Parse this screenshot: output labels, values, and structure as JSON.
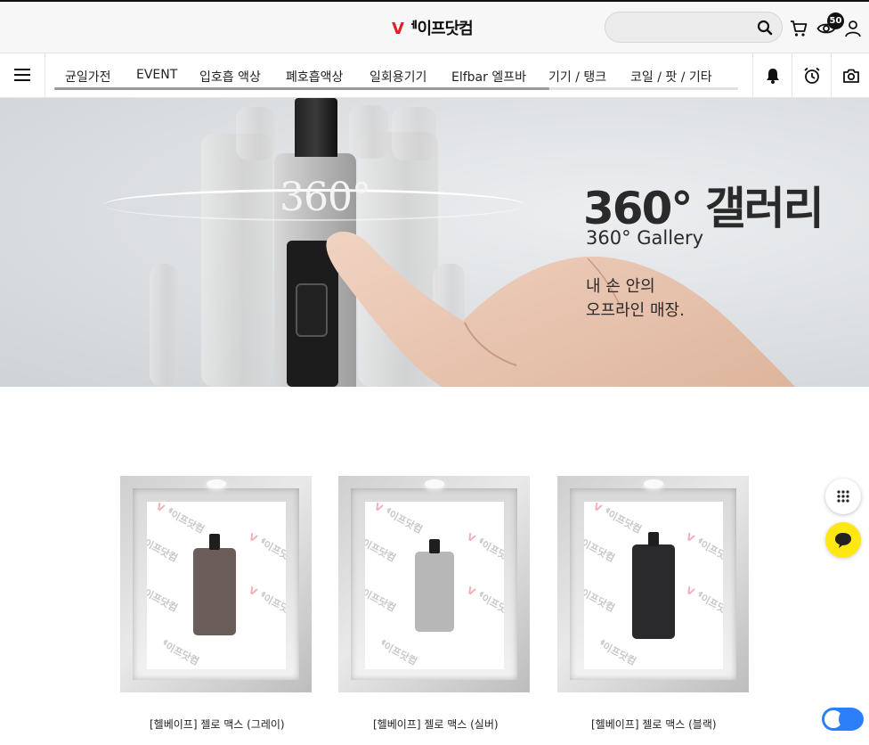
{
  "header": {
    "logo_v": "V",
    "logo_text": "ᅦ이프닷컴",
    "search_placeholder": "",
    "wishlist_count": "50"
  },
  "nav": {
    "categories": [
      {
        "label": "균일가전"
      },
      {
        "label": "EVENT"
      },
      {
        "label": "입호흡 액상"
      },
      {
        "label": "폐호흡액상"
      },
      {
        "label": "일회용기기"
      },
      {
        "label": "Elfbar 엘프바"
      },
      {
        "label": "기기 / 탱크"
      },
      {
        "label": "코일 / 팟 / 기타"
      }
    ]
  },
  "banner": {
    "device_text": "360°",
    "title": "360° 갤러리",
    "subtitle": "360° Gallery",
    "copy_line1": "내 손 안의",
    "copy_line2": "오프라인 매장."
  },
  "products": [
    {
      "name": "[헬베이프] 젤로 맥스 (그레이)",
      "color": "#6b5e5a"
    },
    {
      "name": "[헬베이프] 젤로 맥스 (실버)",
      "color": "#b7b7b7"
    },
    {
      "name": "[헬베이프] 젤로 맥스 (블랙)",
      "color": "#2a2a2c"
    }
  ],
  "watermark": {
    "v": "V",
    "text": "ᅦ이프닷컴"
  },
  "colors": {
    "brand_red": "#e11d2e",
    "kakao_yellow": "#ffe812",
    "accent_blue": "#2d7ff9"
  }
}
